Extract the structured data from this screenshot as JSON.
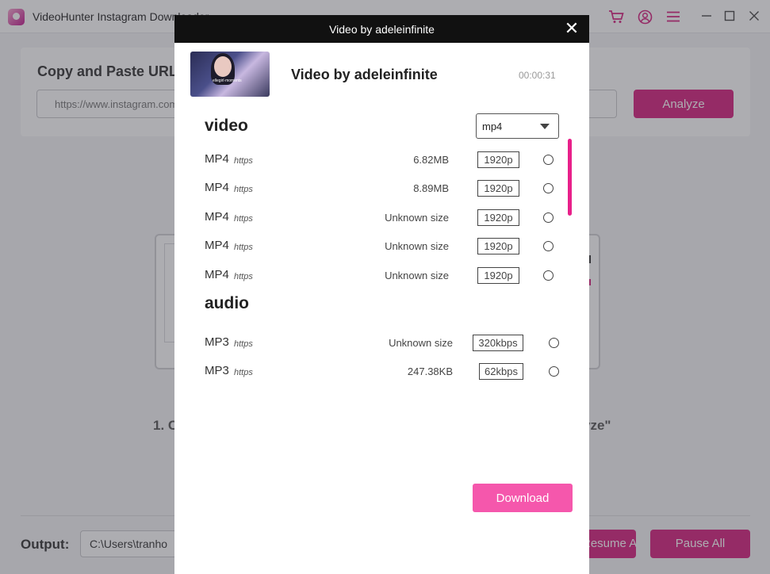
{
  "app": {
    "title": "VideoHunter Instagram Downloader"
  },
  "main": {
    "panel_title": "Copy and Paste URL",
    "url_placeholder": "https://www.instagram.com",
    "analyze_label": "Analyze",
    "step_left": "1. C",
    "step_right": "yze\"",
    "output_label": "Output:",
    "output_path": "C:\\Users\\tranho",
    "resume_label": "Resume All",
    "pause_label": "Pause All"
  },
  "modal": {
    "header_title": "Video by adeleinfinite",
    "close_glyph": "✕",
    "video_title": "Video by adeleinfinite",
    "duration": "00:00:31",
    "thumbnail_caption": "ellegirl·moments",
    "video_section_label": "video",
    "audio_section_label": "audio",
    "format_select": {
      "selected": "mp4"
    },
    "video_rows": [
      {
        "type": "MP4",
        "protocol": "https",
        "size": "6.82MB",
        "quality": "1920p"
      },
      {
        "type": "MP4",
        "protocol": "https",
        "size": "8.89MB",
        "quality": "1920p"
      },
      {
        "type": "MP4",
        "protocol": "https",
        "size": "Unknown size",
        "quality": "1920p"
      },
      {
        "type": "MP4",
        "protocol": "https",
        "size": "Unknown size",
        "quality": "1920p"
      },
      {
        "type": "MP4",
        "protocol": "https",
        "size": "Unknown size",
        "quality": "1920p"
      }
    ],
    "audio_rows": [
      {
        "type": "MP3",
        "protocol": "https",
        "size": "Unknown size",
        "quality": "320kbps"
      },
      {
        "type": "MP3",
        "protocol": "https",
        "size": "247.38KB",
        "quality": "62kbps"
      }
    ],
    "download_label": "Download"
  },
  "colors": {
    "accent": "#d6207f",
    "download_button": "#f557ac",
    "modal_header": "#111111"
  },
  "icons": {
    "cart": "cart-icon",
    "account": "user-circle-icon",
    "menu": "menu-icon",
    "minimize": "minimize-icon",
    "maximize": "maximize-icon",
    "close": "close-icon"
  }
}
